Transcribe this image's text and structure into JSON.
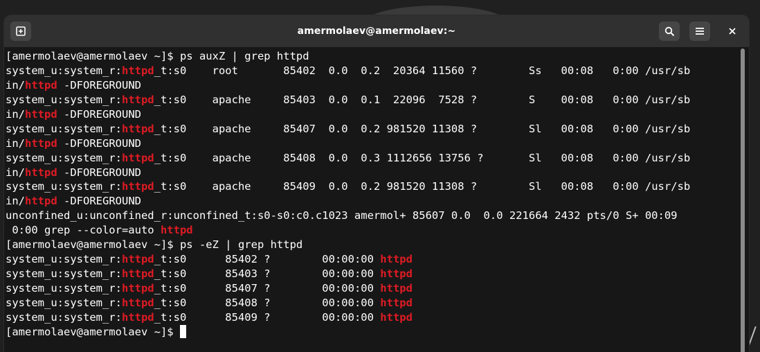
{
  "window": {
    "title": "amermolaev@amermolaev:~"
  },
  "titlebar": {
    "new_tab_icon": "new-tab-icon",
    "search_icon": "search-icon",
    "menu_icon": "hamburger-menu-icon",
    "close_icon": "close-icon"
  },
  "colors": {
    "highlight": "#e01b24",
    "text": "#ffffff",
    "background": "#171717",
    "titlebar": "#303030"
  },
  "terminal": {
    "lines": [
      [
        {
          "t": "[amermolaev@amermolaev ~]$ ps auxZ | grep httpd"
        }
      ],
      [
        {
          "t": "system_u:system_r:"
        },
        {
          "t": "httpd",
          "h": true
        },
        {
          "t": "_t:s0    root       85402  0.0  0.2  20364 11560 ?        Ss   00:08   0:00 /usr/sb"
        }
      ],
      [
        {
          "t": "in/"
        },
        {
          "t": "httpd",
          "h": true
        },
        {
          "t": " -DFOREGROUND"
        }
      ],
      [
        {
          "t": "system_u:system_r:"
        },
        {
          "t": "httpd",
          "h": true
        },
        {
          "t": "_t:s0    apache     85403  0.0  0.1  22096  7528 ?        S    00:08   0:00 /usr/sb"
        }
      ],
      [
        {
          "t": "in/"
        },
        {
          "t": "httpd",
          "h": true
        },
        {
          "t": " -DFOREGROUND"
        }
      ],
      [
        {
          "t": "system_u:system_r:"
        },
        {
          "t": "httpd",
          "h": true
        },
        {
          "t": "_t:s0    apache     85407  0.0  0.2 981520 11308 ?        Sl   00:08   0:00 /usr/sb"
        }
      ],
      [
        {
          "t": "in/"
        },
        {
          "t": "httpd",
          "h": true
        },
        {
          "t": " -DFOREGROUND"
        }
      ],
      [
        {
          "t": "system_u:system_r:"
        },
        {
          "t": "httpd",
          "h": true
        },
        {
          "t": "_t:s0    apache     85408  0.0  0.3 1112656 13756 ?       Sl   00:08   0:00 /usr/sb"
        }
      ],
      [
        {
          "t": "in/"
        },
        {
          "t": "httpd",
          "h": true
        },
        {
          "t": " -DFOREGROUND"
        }
      ],
      [
        {
          "t": "system_u:system_r:"
        },
        {
          "t": "httpd",
          "h": true
        },
        {
          "t": "_t:s0    apache     85409  0.0  0.2 981520 11308 ?        Sl   00:08   0:00 /usr/sb"
        }
      ],
      [
        {
          "t": "in/"
        },
        {
          "t": "httpd",
          "h": true
        },
        {
          "t": " -DFOREGROUND"
        }
      ],
      [
        {
          "t": "unconfined_u:unconfined_r:unconfined_t:s0-s0:c0.c1023 amermol+ 85607 0.0  0.0 221664 2432 pts/0 S+ 00:09"
        }
      ],
      [
        {
          "t": " 0:00 grep --color=auto "
        },
        {
          "t": "httpd",
          "h": true
        }
      ],
      [
        {
          "t": "[amermolaev@amermolaev ~]$ ps -eZ | grep httpd"
        }
      ],
      [
        {
          "t": "system_u:system_r:"
        },
        {
          "t": "httpd",
          "h": true
        },
        {
          "t": "_t:s0      85402 ?        00:00:00 "
        },
        {
          "t": "httpd",
          "h": true
        }
      ],
      [
        {
          "t": "system_u:system_r:"
        },
        {
          "t": "httpd",
          "h": true
        },
        {
          "t": "_t:s0      85403 ?        00:00:00 "
        },
        {
          "t": "httpd",
          "h": true
        }
      ],
      [
        {
          "t": "system_u:system_r:"
        },
        {
          "t": "httpd",
          "h": true
        },
        {
          "t": "_t:s0      85407 ?        00:00:00 "
        },
        {
          "t": "httpd",
          "h": true
        }
      ],
      [
        {
          "t": "system_u:system_r:"
        },
        {
          "t": "httpd",
          "h": true
        },
        {
          "t": "_t:s0      85408 ?        00:00:00 "
        },
        {
          "t": "httpd",
          "h": true
        }
      ],
      [
        {
          "t": "system_u:system_r:"
        },
        {
          "t": "httpd",
          "h": true
        },
        {
          "t": "_t:s0      85409 ?        00:00:00 "
        },
        {
          "t": "httpd",
          "h": true
        }
      ]
    ],
    "prompt": "[amermolaev@amermolaev ~]$ "
  }
}
